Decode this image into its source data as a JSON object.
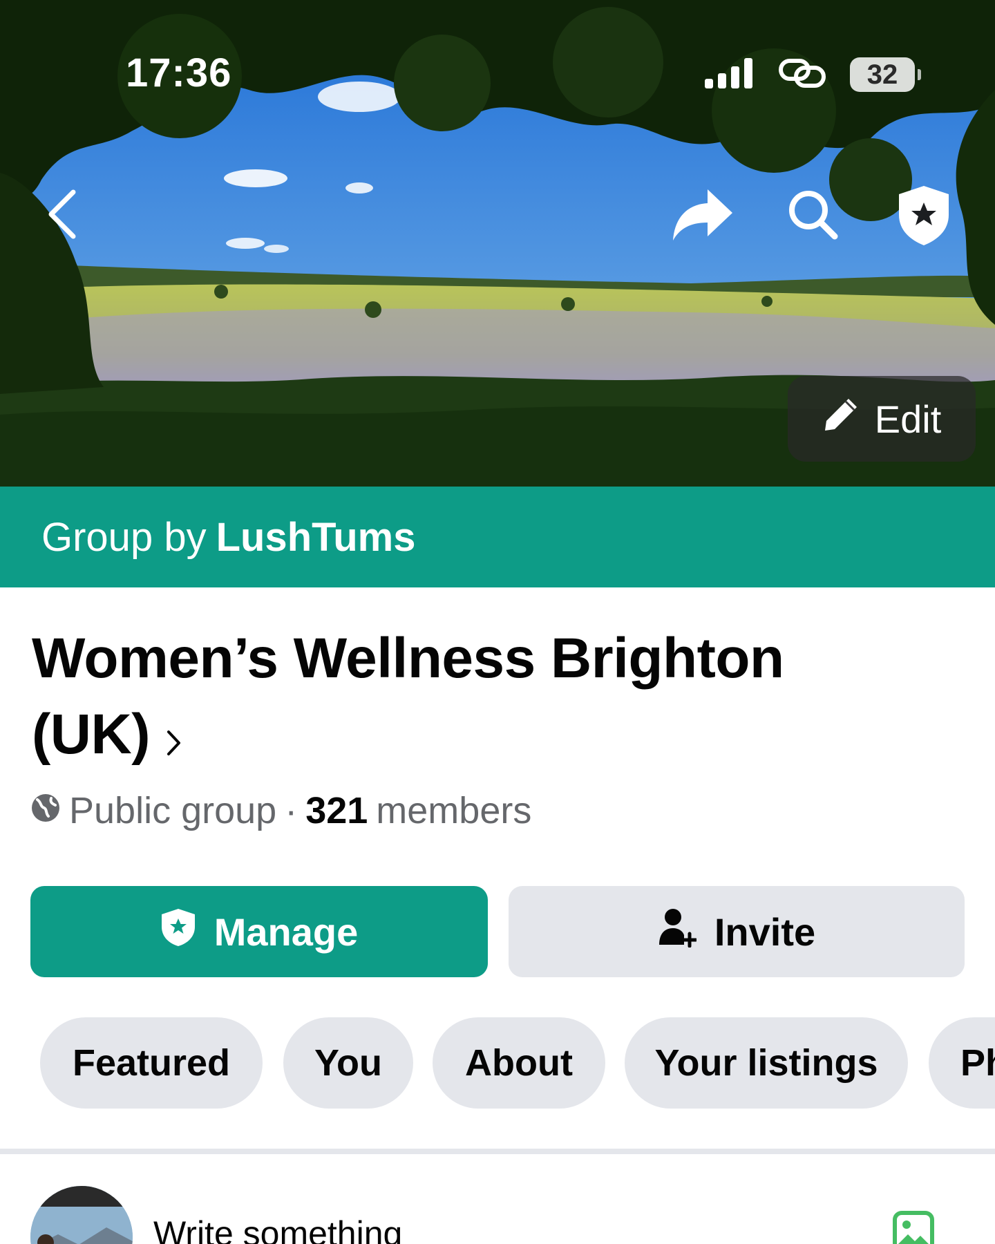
{
  "status_bar": {
    "time": "17:36",
    "battery": "32",
    "icons": [
      "signal-icon",
      "hotspot-link-icon",
      "battery-icon"
    ]
  },
  "cover": {
    "icons": [
      "back-chevron-icon",
      "share-arrow-icon",
      "search-icon",
      "admin-shield-icon"
    ],
    "edit_label": "Edit"
  },
  "group": {
    "by_prefix": "Group by",
    "by_name": "LushTums",
    "name": "Women’s Wellness Brighton (UK)",
    "privacy": "Public group",
    "separator": "·",
    "member_count": "321",
    "members_word": "members"
  },
  "actions": {
    "manage_label": "Manage",
    "invite_label": "Invite"
  },
  "tabs": [
    {
      "label": "Featured"
    },
    {
      "label": "You"
    },
    {
      "label": "About"
    },
    {
      "label": "Your listings"
    },
    {
      "label": "Ph"
    }
  ],
  "composer": {
    "placeholder": "Write something"
  },
  "colors": {
    "accent": "#0d9c87",
    "button_grey": "#e4e6eb",
    "text_primary": "#050505",
    "text_secondary": "#65676b"
  }
}
